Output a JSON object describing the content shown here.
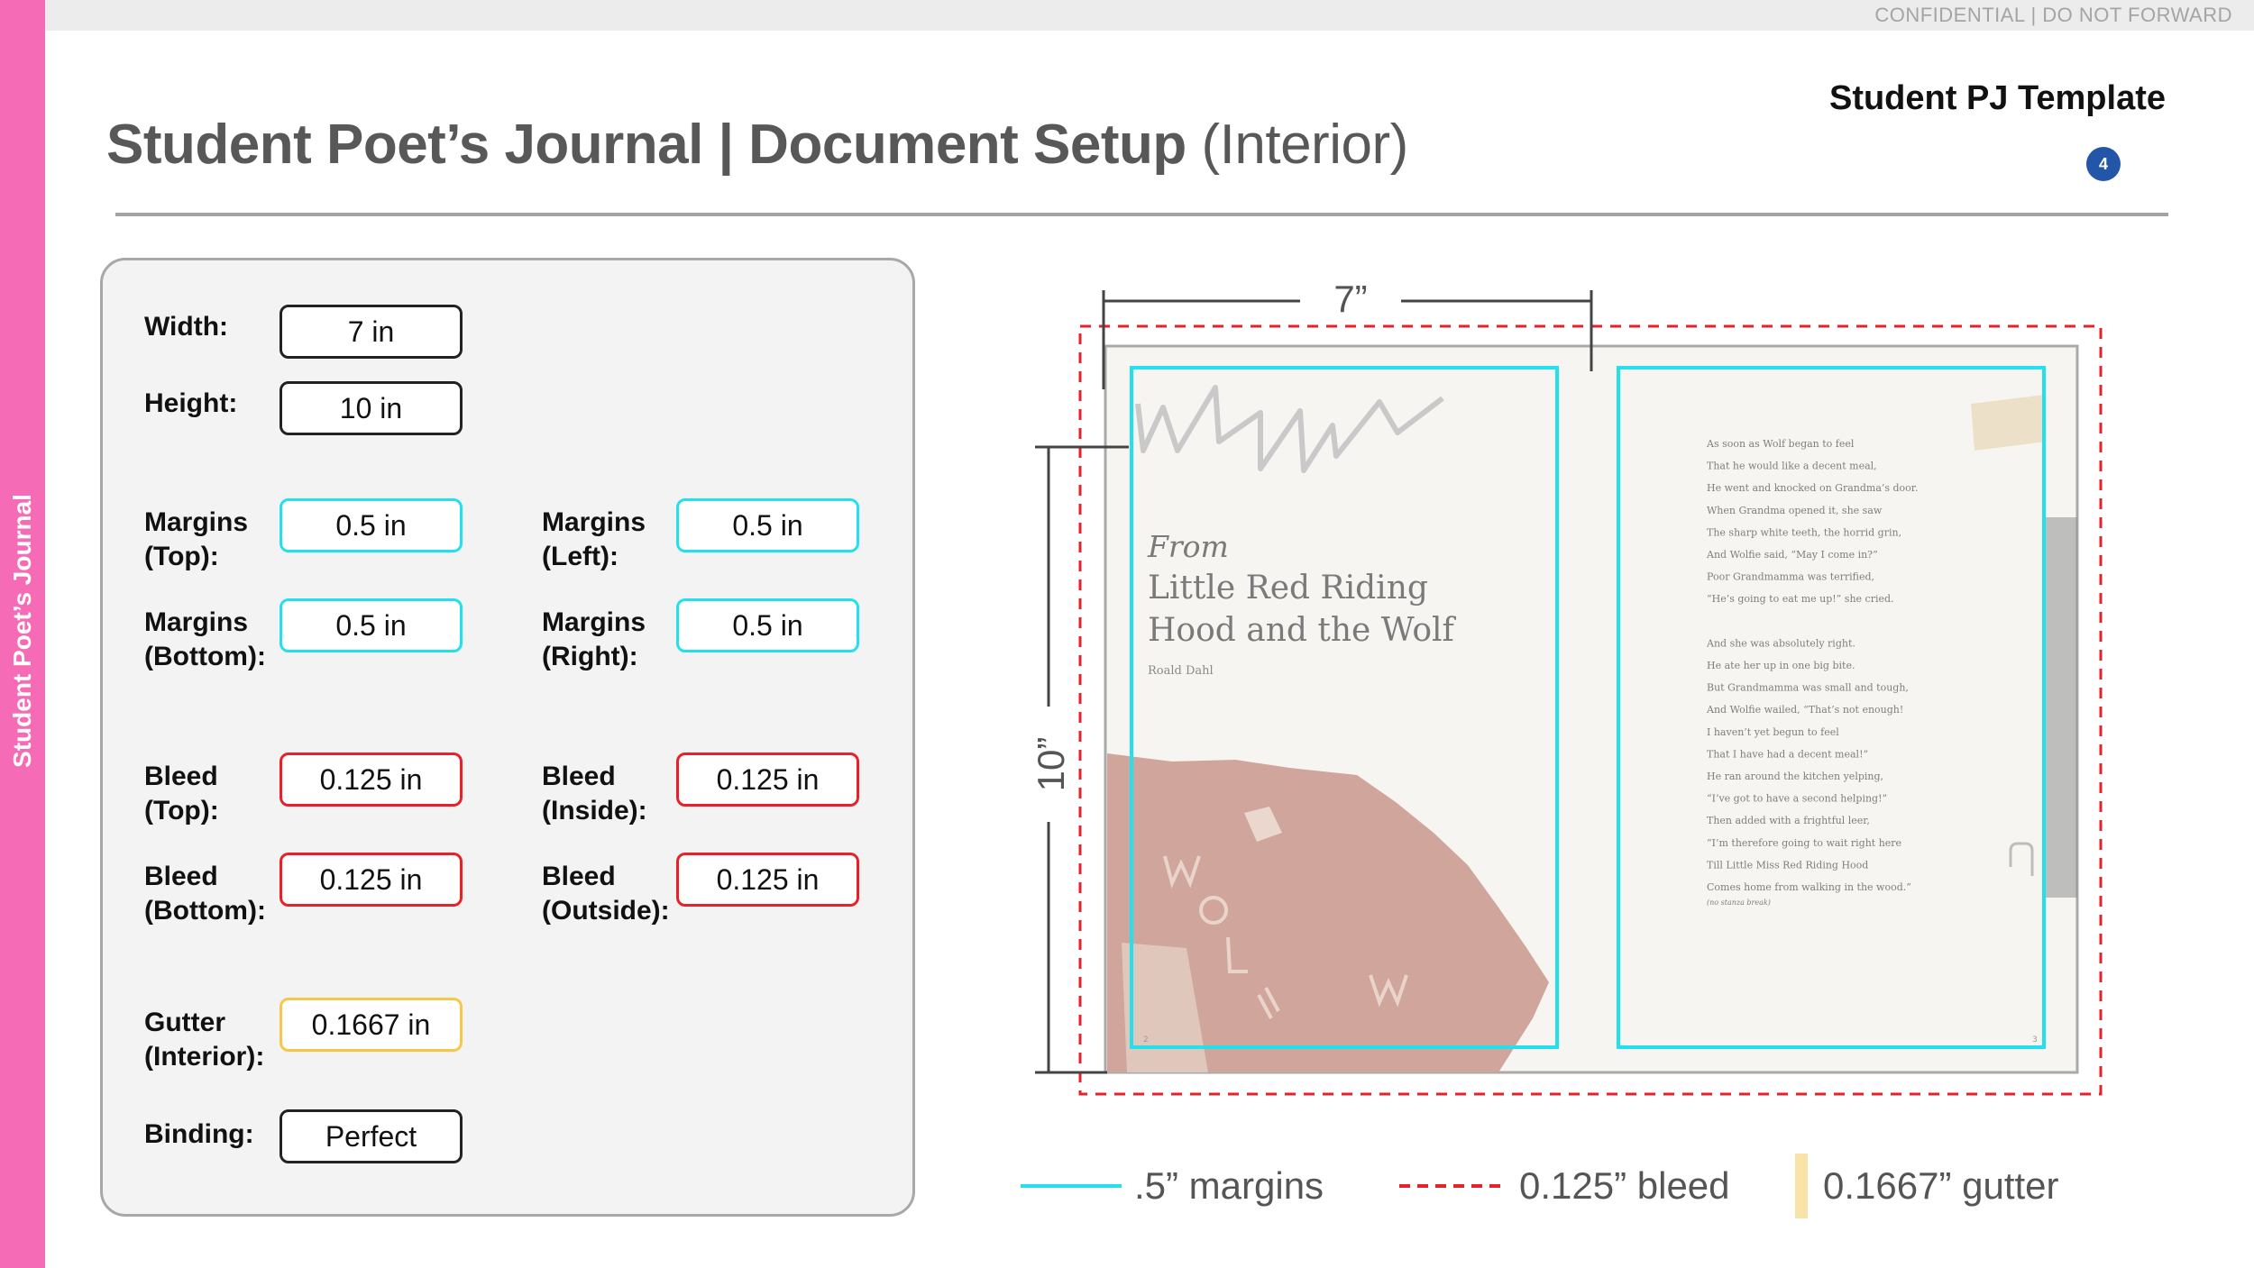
{
  "header": {
    "confidential": "CONFIDENTIAL | DO NOT FORWARD",
    "title_main": "Student Poet’s Journal | Document Setup ",
    "title_sub": "(Interior)",
    "template_label": "Student PJ Template",
    "page_number": "4"
  },
  "sidebar": {
    "label": "Student Poet’s Journal"
  },
  "colors": {
    "accent_pink": "#f56bb5",
    "margin_cyan": "#22e0ee",
    "bleed_red": "#e7202a",
    "gutter_yellow": "#f5c84b",
    "badge_blue": "#2356a8"
  },
  "setup": {
    "width": {
      "label": "Width:",
      "value": "7 in"
    },
    "height": {
      "label": "Height:",
      "value": "10 in"
    },
    "margin_top": {
      "label1": "Margins",
      "label2": "(Top):",
      "value": "0.5 in"
    },
    "margin_bottom": {
      "label1": "Margins",
      "label2": "(Bottom):",
      "value": "0.5 in"
    },
    "margin_left": {
      "label1": "Margins",
      "label2": "(Left):",
      "value": "0.5 in"
    },
    "margin_right": {
      "label1": "Margins",
      "label2": "(Right):",
      "value": "0.5 in"
    },
    "bleed_top": {
      "label1": "Bleed",
      "label2": "(Top):",
      "value": "0.125 in"
    },
    "bleed_bottom": {
      "label1": "Bleed",
      "label2": "(Bottom):",
      "value": "0.125 in"
    },
    "bleed_inside": {
      "label1": "Bleed",
      "label2": "(Inside):",
      "value": "0.125 in"
    },
    "bleed_outside": {
      "label1": "Bleed",
      "label2": "(Outside):",
      "value": "0.125 in"
    },
    "gutter": {
      "label1": "Gutter",
      "label2": "(Interior):",
      "value": "0.1667 in"
    },
    "binding": {
      "label": "Binding:",
      "value": "Perfect"
    }
  },
  "diagram": {
    "width_dim": "7”",
    "height_dim": "10”",
    "left_page": {
      "from": "From",
      "title_line1": "Little Red Riding",
      "title_line2": "Hood and the Wolf",
      "author": "Roald Dahl",
      "page_num": "2"
    },
    "right_page": {
      "poem_lines": [
        "As soon as Wolf began to feel",
        "That he would like a decent meal,",
        "He went and knocked on Grandma’s door.",
        "When Grandma opened it, she saw",
        "The sharp white teeth, the horrid grin,",
        "And Wolfie said, “May I come in?”",
        "Poor Grandmamma was terrified,",
        "“He’s going to eat me up!” she cried.",
        "",
        "And she was absolutely right.",
        "He ate her up in one big bite.",
        "But Grandmamma was small and tough,",
        "And Wolfie wailed, “That’s not enough!",
        "I haven’t yet begun to feel",
        "That I have had a decent meal!”",
        "He ran around the kitchen yelping,",
        "“I’ve got to have a second helping!”",
        "Then added with a frightful leer,",
        "“I’m therefore going to wait right here",
        "Till Little Miss Red Riding Hood",
        "Comes home from walking in the wood.”",
        "(no stanza break)"
      ],
      "page_num": "3"
    }
  },
  "legend": {
    "margins": ".5” margins",
    "bleed": "0.125” bleed",
    "gutter": "0.1667” gutter"
  }
}
